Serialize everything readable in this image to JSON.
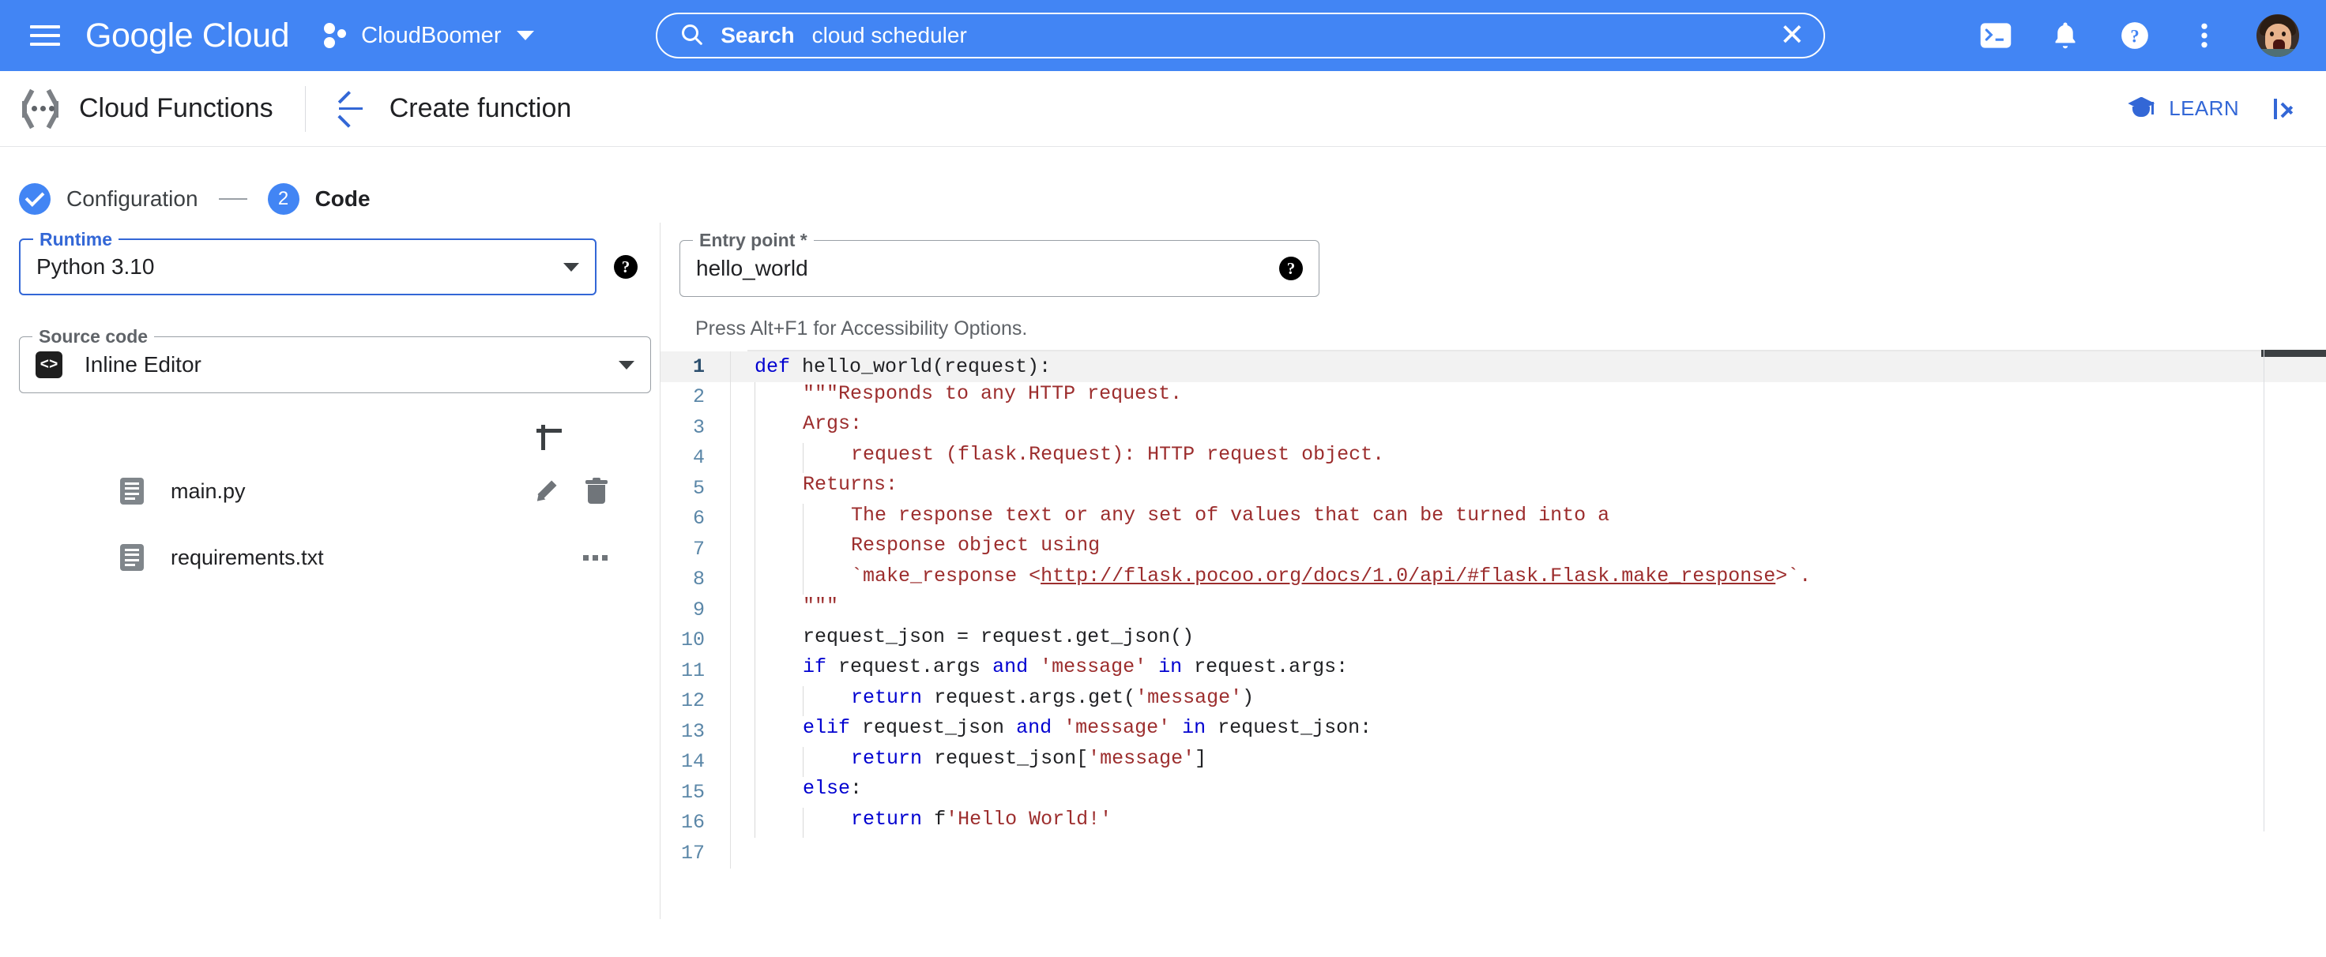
{
  "topbar": {
    "menu_icon": "hamburger-icon",
    "brand": "Google Cloud",
    "project_name": "CloudBoomer",
    "search": {
      "label": "Search",
      "value": "cloud scheduler",
      "placeholder": "Search",
      "clear": "✕"
    },
    "icons": [
      "cloud-shell-icon",
      "notifications-icon",
      "help-icon",
      "more-options-icon"
    ],
    "accent": "#4285f4"
  },
  "subheader": {
    "product": "Cloud Functions",
    "page_title": "Create function",
    "learn_label": "LEARN",
    "collapse_label": "collapse-panel"
  },
  "stepper": {
    "steps": [
      {
        "num": "✓",
        "label": "Configuration",
        "state": "complete"
      },
      {
        "num": "2",
        "label": "Code",
        "state": "active"
      }
    ]
  },
  "form": {
    "runtime": {
      "legend": "Runtime",
      "value": "Python 3.10",
      "focused": true
    },
    "source_code": {
      "legend": "Source code",
      "value": "Inline Editor",
      "icon": "code-brackets-icon"
    },
    "entry_point": {
      "legend": "Entry point *",
      "value": "hello_world",
      "placeholder": "Entry point"
    }
  },
  "files": {
    "add_label": "add-file",
    "items": [
      {
        "name": "main.py",
        "actions": [
          "edit",
          "delete"
        ]
      },
      {
        "name": "requirements.txt",
        "actions": [
          "more"
        ]
      }
    ]
  },
  "editor": {
    "a11y_hint": "Press Alt+F1 for Accessibility Options.",
    "lines": [
      {
        "n": "1",
        "active": true,
        "indent": 0,
        "segs": [
          {
            "t": "def ",
            "c": "kw"
          },
          {
            "t": "hello_world(request):",
            "c": ""
          }
        ]
      },
      {
        "n": "2",
        "active": false,
        "indent": 1,
        "segs": [
          {
            "t": "\"\"\"Responds to any HTTP request.",
            "c": "doc"
          }
        ]
      },
      {
        "n": "3",
        "active": false,
        "indent": 1,
        "segs": [
          {
            "t": "Args:",
            "c": "doc"
          }
        ]
      },
      {
        "n": "4",
        "active": false,
        "indent": 2,
        "segs": [
          {
            "t": "request (flask.Request): HTTP request object.",
            "c": "doc"
          }
        ]
      },
      {
        "n": "5",
        "active": false,
        "indent": 1,
        "segs": [
          {
            "t": "Returns:",
            "c": "doc"
          }
        ]
      },
      {
        "n": "6",
        "active": false,
        "indent": 2,
        "segs": [
          {
            "t": "The response text or any set of values that can be turned into a",
            "c": "doc"
          }
        ]
      },
      {
        "n": "7",
        "active": false,
        "indent": 2,
        "segs": [
          {
            "t": "Response object using",
            "c": "doc"
          }
        ]
      },
      {
        "n": "8",
        "active": false,
        "indent": 2,
        "segs": [
          {
            "t": "`make_response <",
            "c": "doc"
          },
          {
            "t": "http://flask.pocoo.org/docs/1.0/api/#flask.Flask.make_response",
            "c": "lnk"
          },
          {
            "t": ">`.",
            "c": "doc"
          }
        ]
      },
      {
        "n": "9",
        "active": false,
        "indent": 1,
        "segs": [
          {
            "t": "\"\"\"",
            "c": "doc"
          }
        ]
      },
      {
        "n": "10",
        "active": false,
        "indent": 1,
        "segs": [
          {
            "t": "request_json = request.get_json()",
            "c": ""
          }
        ]
      },
      {
        "n": "11",
        "active": false,
        "indent": 1,
        "segs": [
          {
            "t": "if ",
            "c": "kw"
          },
          {
            "t": "request.args ",
            "c": ""
          },
          {
            "t": "and ",
            "c": "kw"
          },
          {
            "t": "'message' ",
            "c": "str"
          },
          {
            "t": "in ",
            "c": "kw"
          },
          {
            "t": "request.args:",
            "c": ""
          }
        ]
      },
      {
        "n": "12",
        "active": false,
        "indent": 2,
        "segs": [
          {
            "t": "return ",
            "c": "kw"
          },
          {
            "t": "request.args.get(",
            "c": ""
          },
          {
            "t": "'message'",
            "c": "str"
          },
          {
            "t": ")",
            "c": ""
          }
        ]
      },
      {
        "n": "13",
        "active": false,
        "indent": 1,
        "segs": [
          {
            "t": "elif ",
            "c": "kw"
          },
          {
            "t": "request_json ",
            "c": ""
          },
          {
            "t": "and ",
            "c": "kw"
          },
          {
            "t": "'message' ",
            "c": "str"
          },
          {
            "t": "in ",
            "c": "kw"
          },
          {
            "t": "request_json:",
            "c": ""
          }
        ]
      },
      {
        "n": "14",
        "active": false,
        "indent": 2,
        "segs": [
          {
            "t": "return ",
            "c": "kw"
          },
          {
            "t": "request_json[",
            "c": ""
          },
          {
            "t": "'message'",
            "c": "str"
          },
          {
            "t": "]",
            "c": ""
          }
        ]
      },
      {
        "n": "15",
        "active": false,
        "indent": 1,
        "segs": [
          {
            "t": "else",
            "c": "kw"
          },
          {
            "t": ":",
            "c": ""
          }
        ]
      },
      {
        "n": "16",
        "active": false,
        "indent": 2,
        "segs": [
          {
            "t": "return ",
            "c": "kw"
          },
          {
            "t": "f",
            "c": ""
          },
          {
            "t": "'Hello World!'",
            "c": "str"
          }
        ]
      },
      {
        "n": "17",
        "active": false,
        "indent": 0,
        "segs": [
          {
            "t": "",
            "c": ""
          }
        ]
      }
    ]
  }
}
